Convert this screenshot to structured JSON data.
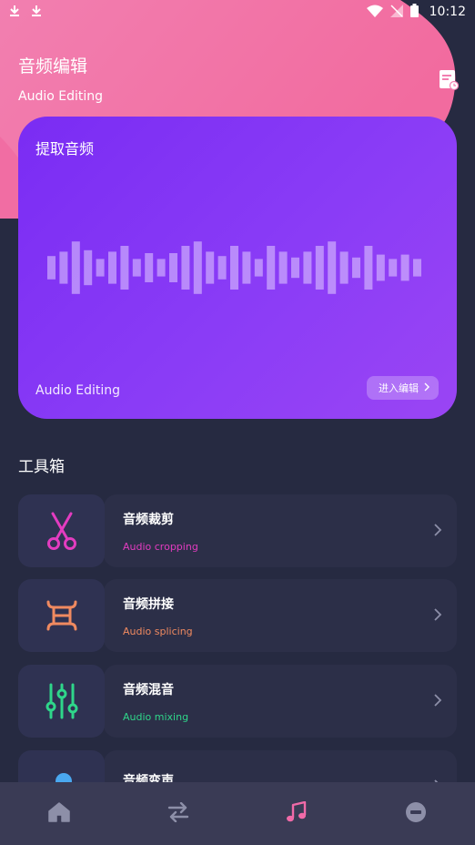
{
  "header": {
    "title": "音频编辑",
    "subtitle": "Audio Editing"
  },
  "status_bar": {
    "time": "10:12",
    "icons": [
      "download-icon",
      "download-icon",
      "wifi-icon",
      "no-signal-icon",
      "battery-icon"
    ]
  },
  "hero": {
    "title": "提取音频",
    "footer": "Audio Editing",
    "button_label": "进入编辑",
    "wave_bars": [
      0.4,
      0.55,
      0.9,
      0.6,
      0.3,
      0.55,
      0.75,
      0.3,
      0.5,
      0.3,
      0.5,
      0.75,
      0.9,
      0.55,
      0.4,
      0.75,
      0.55,
      0.3,
      0.75,
      0.55,
      0.35,
      0.55,
      0.75,
      0.9,
      0.55,
      0.35,
      0.75,
      0.45,
      0.3,
      0.45,
      0.3
    ]
  },
  "toolbox": {
    "title": "工具箱",
    "items": [
      {
        "name": "音频裁剪",
        "subtitle": "Audio cropping",
        "icon": "scissors-icon",
        "color": "#e33cc0"
      },
      {
        "name": "音频拼接",
        "subtitle": "Audio splicing",
        "icon": "splice-icon",
        "color": "#f08a60"
      },
      {
        "name": "音频混音",
        "subtitle": "Audio mixing",
        "icon": "mixer-sliders-icon",
        "color": "#2fd68a"
      },
      {
        "name": "音频变声",
        "subtitle": "",
        "icon": "voice-changer-icon",
        "color": "#4aa8f0"
      }
    ]
  },
  "bottom_nav": {
    "items": [
      {
        "icon": "home-icon",
        "active": false
      },
      {
        "icon": "swap-arrows-icon",
        "active": false
      },
      {
        "icon": "music-note-icon",
        "active": true
      },
      {
        "icon": "profile-icon",
        "active": false
      }
    ],
    "active_color": "#f06aa8",
    "inactive_color": "#8d8fa8"
  },
  "colors": {
    "background": "#262a41",
    "hero_gradient_start": "#7a2cf3",
    "hero_gradient_end": "#9a45f4",
    "blob_pink": "#f47cab"
  }
}
